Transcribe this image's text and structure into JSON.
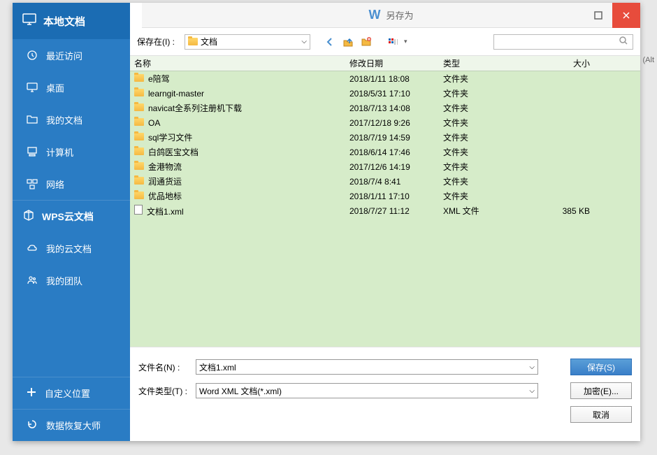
{
  "dialog": {
    "title": "另存为"
  },
  "sidebar": {
    "header": "本地文档",
    "items": [
      {
        "label": "最近访问",
        "icon": "clock"
      },
      {
        "label": "桌面",
        "icon": "monitor"
      },
      {
        "label": "我的文档",
        "icon": "folder"
      },
      {
        "label": "计算机",
        "icon": "computer"
      },
      {
        "label": "网络",
        "icon": "network"
      }
    ],
    "cloud_header": "WPS云文档",
    "cloud_items": [
      {
        "label": "我的云文档",
        "icon": "cloud"
      },
      {
        "label": "我的团队",
        "icon": "team"
      }
    ],
    "footer": [
      {
        "label": "自定义位置",
        "icon": "plus"
      },
      {
        "label": "数据恢复大师",
        "icon": "recovery"
      }
    ]
  },
  "toolbar": {
    "save_in_label": "保存在(I) :",
    "location": "文档",
    "search_placeholder": ""
  },
  "columns": {
    "name": "名称",
    "date": "修改日期",
    "type": "类型",
    "size": "大小"
  },
  "files": [
    {
      "name": "e陪驾",
      "date": "2018/1/11 18:08",
      "type": "文件夹",
      "size": "",
      "kind": "folder"
    },
    {
      "name": "learngit-master",
      "date": "2018/5/31 17:10",
      "type": "文件夹",
      "size": "",
      "kind": "folder"
    },
    {
      "name": "navicat全系列注册机下载",
      "date": "2018/7/13 14:08",
      "type": "文件夹",
      "size": "",
      "kind": "folder"
    },
    {
      "name": "OA",
      "date": "2017/12/18 9:26",
      "type": "文件夹",
      "size": "",
      "kind": "folder"
    },
    {
      "name": "sql学习文件",
      "date": "2018/7/19 14:59",
      "type": "文件夹",
      "size": "",
      "kind": "folder"
    },
    {
      "name": "白鸽医宝文档",
      "date": "2018/6/14 17:46",
      "type": "文件夹",
      "size": "",
      "kind": "folder"
    },
    {
      "name": "金港物流",
      "date": "2017/12/6 14:19",
      "type": "文件夹",
      "size": "",
      "kind": "folder"
    },
    {
      "name": "润通货运",
      "date": "2018/7/4 8:41",
      "type": "文件夹",
      "size": "",
      "kind": "folder"
    },
    {
      "name": "优品地标",
      "date": "2018/1/11 17:10",
      "type": "文件夹",
      "size": "",
      "kind": "folder"
    },
    {
      "name": "文档1.xml",
      "date": "2018/7/27 11:12",
      "type": "XML 文件",
      "size": "385 KB",
      "kind": "file"
    }
  ],
  "form": {
    "filename_label": "文件名(N) :",
    "filename": "文档1.xml",
    "filetype_label": "文件类型(T) :",
    "filetype": "Word XML 文档(*.xml)",
    "save_btn": "保存(S)",
    "encrypt_btn": "加密(E)...",
    "cancel_btn": "取消"
  },
  "hints": {
    "alt": "(Alt"
  }
}
